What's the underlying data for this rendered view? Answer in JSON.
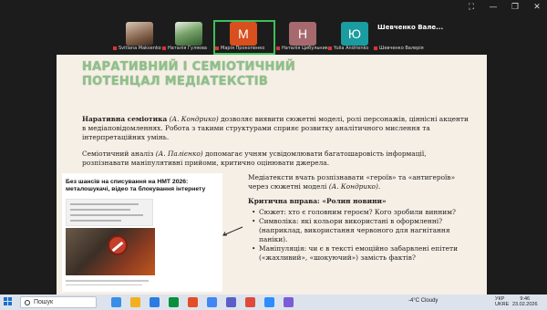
{
  "window": {
    "controls": [
      "⛶",
      "—",
      "❐",
      "✕"
    ]
  },
  "participants": [
    {
      "label": "Svitlana Maksenko",
      "initial": "",
      "style": "photo"
    },
    {
      "label": "Наталія Гуляєва",
      "initial": "",
      "style": "photo2"
    },
    {
      "label": "Марія Прокопенко",
      "initial": "M",
      "color": "#d94f1e",
      "active": true
    },
    {
      "label": "Наталія Цибульник",
      "initial": "H",
      "color": "#a66a6e"
    },
    {
      "label": "Yulia Andrienko",
      "initial": "Ю",
      "color": "#1a9ca0"
    },
    {
      "label": "Шевченко Валерія",
      "header": "Шевченко Вале...",
      "initial": ""
    }
  ],
  "slide": {
    "title_line1": "НАРАТИВНИЙ І СЕМІОТИЧНИЙ",
    "title_line2": "ПОТЕНЦАЛ МЕДІАТЕКСТІВ",
    "p1_bold": "Наративна семіотика",
    "p1_author": "(А. Кондрико)",
    "p1_rest": " дозволяє виявити сюжетні моделі, ролі персонажів, ціннісні акценти в медіаповідомленнях. Робота з такими структурами сприяє розвитку аналітичного мислення та інтерпретаційних умінь.",
    "p2_start": "Семіотичний аналіз ",
    "p2_author": "(А. Палієнко)",
    "p2_rest": " допомагає учням усвідомлювати багатошаровість інформації, розпізнавати маніпулятивні прийоми, критично оцінювати джерела.",
    "news_headline": "Без шансів на списування на НМТ 2026: металошукачі, відео та блокування інтернету",
    "right_intro_start": "Медіатексти вчать розпізнавати «героїв» та «антигероїв» через сюжетні моделі ",
    "right_intro_author": "(А. Кондрико)",
    "right_intro_end": ".",
    "task_title": "Критична вправа: «Ролин новини»",
    "bullets": [
      "Сюжет: хто є головним героєм? Кого зробили винним?",
      "Символіка: які кольори використані в оформленні? (наприклад, використання червоного для нагнітання паніки).",
      "Маніпуляція: чи є в тексті емоційно забарвлені епітети («жахливий», «шокуючий») замість фактів?"
    ]
  },
  "taskbar": {
    "search_label": "Пошук",
    "weather": "-4°C  Cloudy",
    "lang_top": "УКР",
    "lang_bottom": "UKRE",
    "time": "9:46",
    "date": "23.02.2026",
    "app_colors": [
      "#3a8ee6",
      "#f2b01e",
      "#2c7be5",
      "#0a8f3c",
      "#e44d26",
      "#4285f4",
      "#5b5fc7",
      "#e04a3a",
      "#2d8cff",
      "#7b5cd6"
    ]
  }
}
